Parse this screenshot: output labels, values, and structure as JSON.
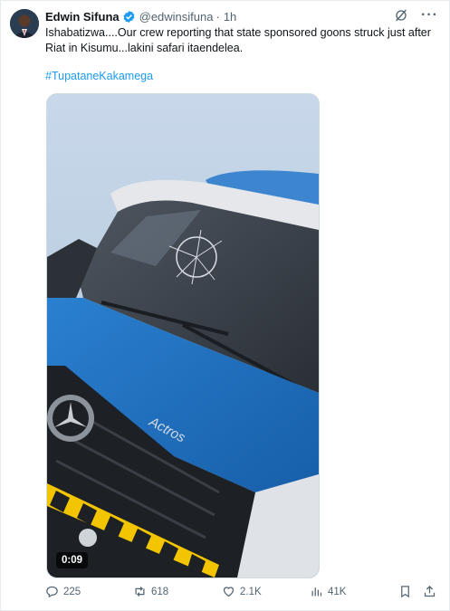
{
  "author": {
    "name": "Edwin Sifuna",
    "handle": "@edwinsifuna",
    "separator": "·",
    "time": "1h"
  },
  "header_icons": [
    "verified-badge-icon",
    "grok-icon",
    "more-options-icon"
  ],
  "tweet": {
    "text": "Ishabatizwa....Our crew reporting that state sponsored goons struck just after Riat in Kisumu...lakini safari itaendelea.",
    "hashtag": "#TupataneKakamega"
  },
  "media": {
    "type": "video",
    "description_icon": "truck-video-thumbnail",
    "duration": "0:09",
    "truck_badge": "Actros"
  },
  "actions": {
    "replies": "225",
    "reposts": "618",
    "likes": "2.1K",
    "views": "41K"
  },
  "colors": {
    "accent": "#1d9bf0",
    "text": "#0f1419",
    "muted": "#536471",
    "truck_blue": "#1f6fbf"
  }
}
